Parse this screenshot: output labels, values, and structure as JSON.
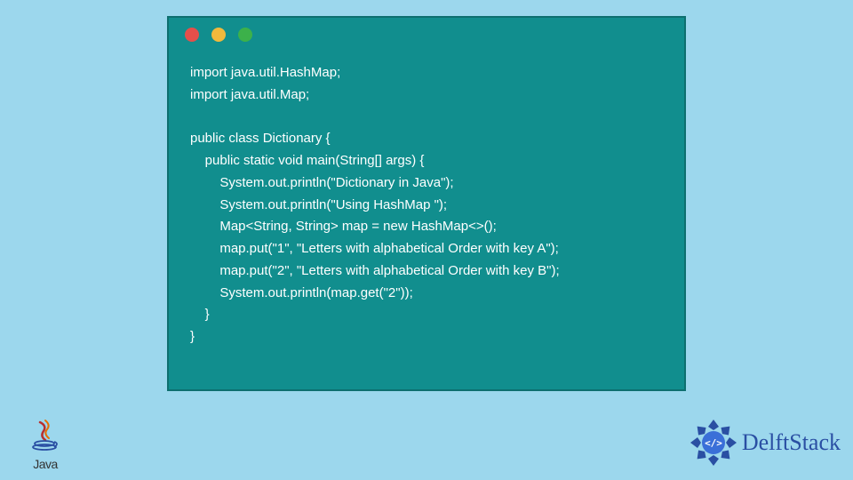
{
  "code": {
    "line1": "import java.util.HashMap;",
    "line2": "import java.util.Map;",
    "blank1": "",
    "line3": "public class Dictionary {",
    "line4": "    public static void main(String[] args) {",
    "line5": "        System.out.println(\"Dictionary in Java\");",
    "line6": "        System.out.println(\"Using HashMap \");",
    "line7": "        Map<String, String> map = new HashMap<>();",
    "line8": "        map.put(\"1\", \"Letters with alphabetical Order with key A\");",
    "line9": "        map.put(\"2\", \"Letters with alphabetical Order with key B\");",
    "line10": "        System.out.println(map.get(\"2\"));",
    "line11": "    }",
    "line12": "}"
  },
  "logos": {
    "java_label": "Java",
    "delft_label": "DelftStack"
  },
  "colors": {
    "page_bg": "#9cd7ed",
    "window_bg": "#118e8e",
    "dot_red": "#e44f4a",
    "dot_yellow": "#f1b93c",
    "dot_green": "#3cb14a",
    "code_text": "#ffffff",
    "delft_blue": "#2a4fa3",
    "java_red": "#b8312f"
  }
}
